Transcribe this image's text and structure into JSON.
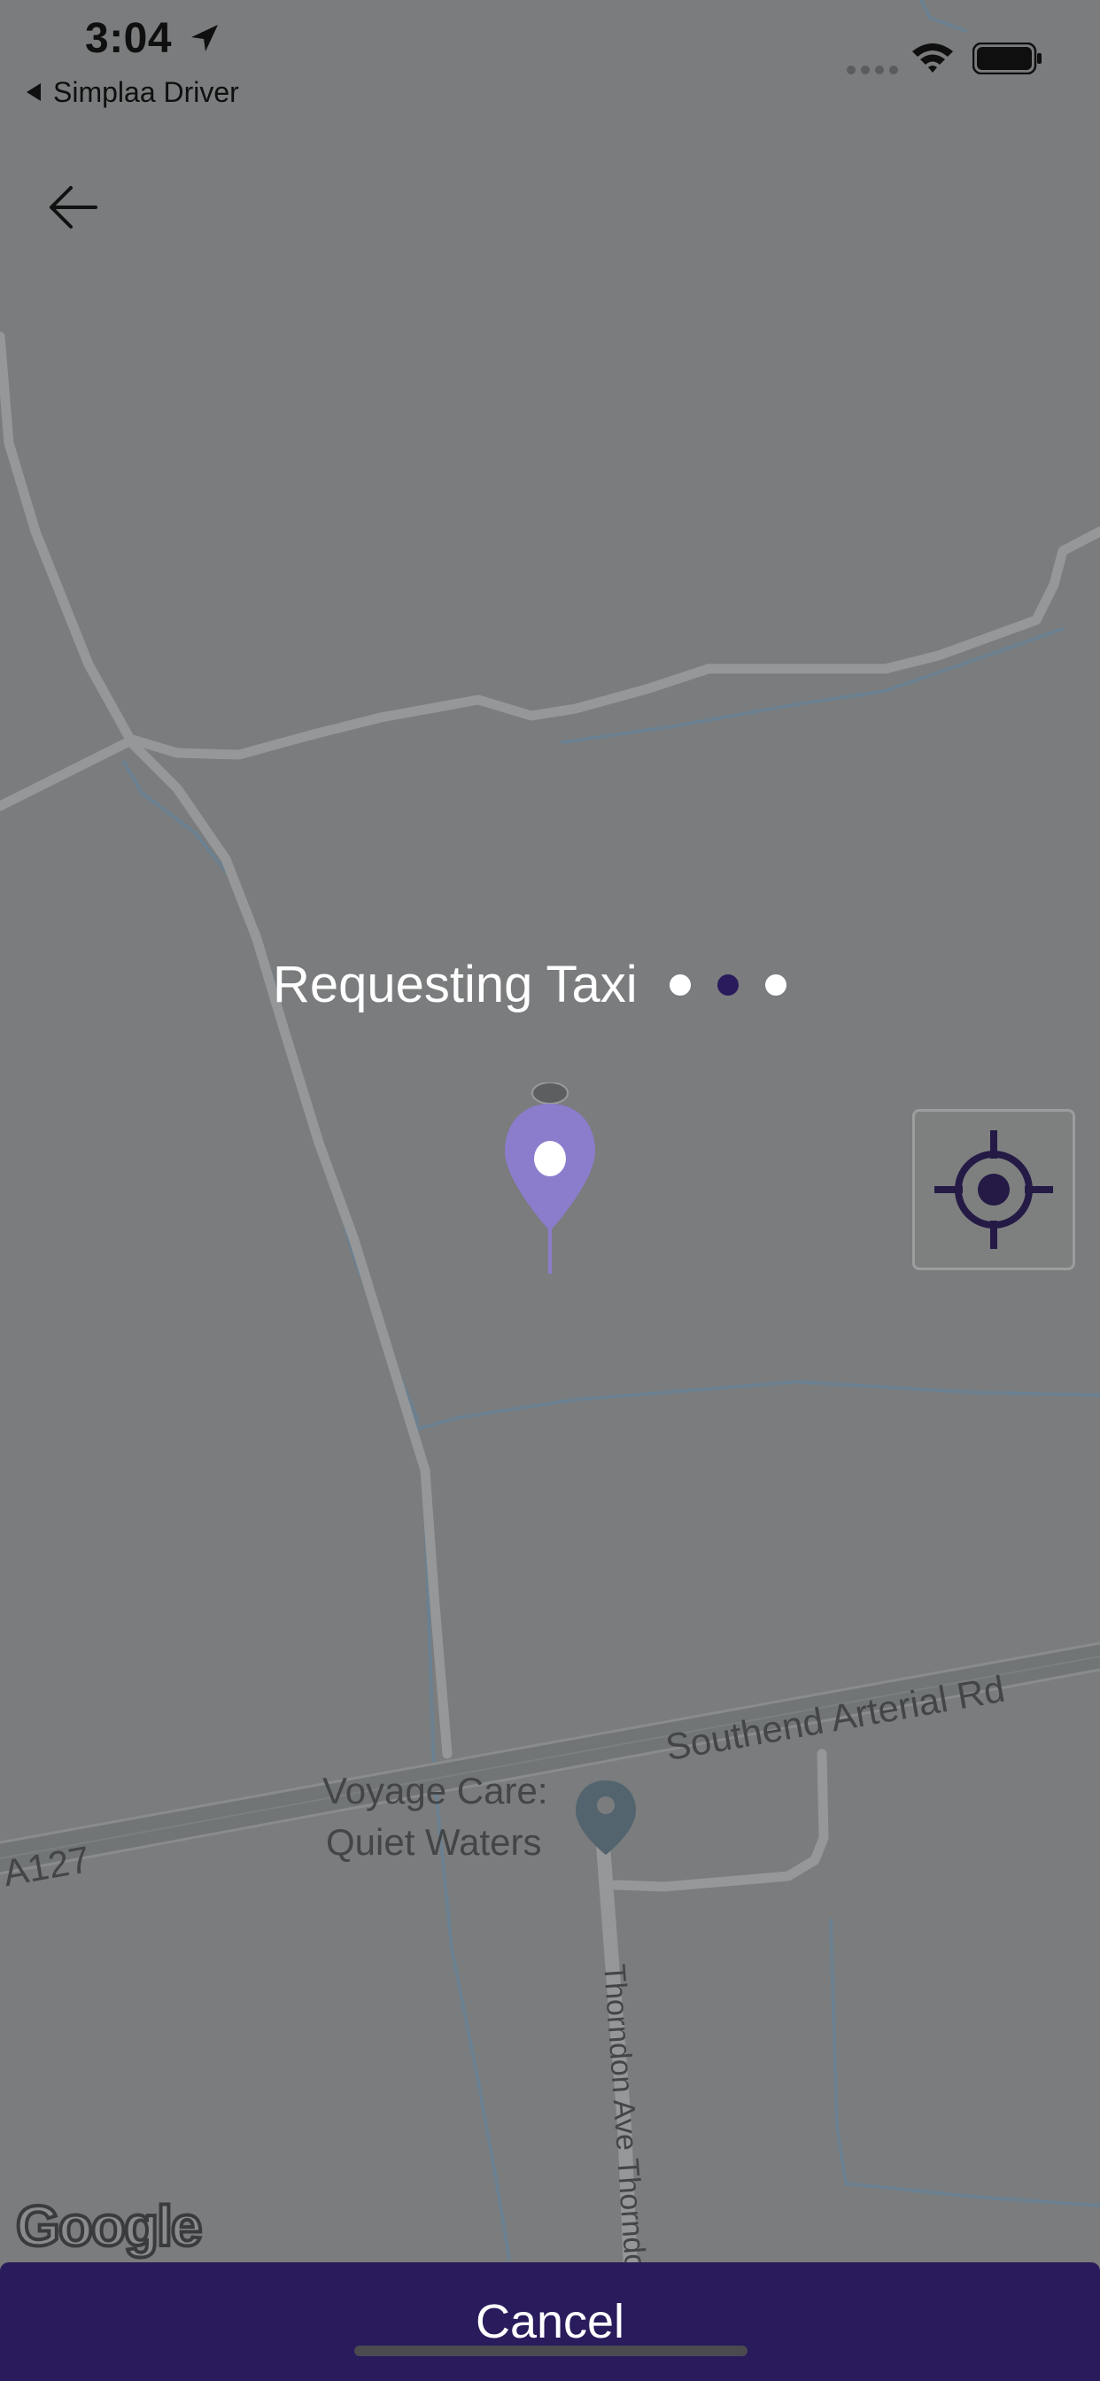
{
  "status_bar": {
    "time": "3:04",
    "back_app_label": "Simplaa Driver",
    "icons": [
      "location-arrow-icon",
      "cellular-signal-icon",
      "wifi-icon",
      "battery-icon"
    ]
  },
  "header": {
    "back_icon": "arrow-left-icon"
  },
  "overlay": {
    "status_text": "Requesting Taxi",
    "dots_total": 3,
    "dot_active_index": 1
  },
  "map": {
    "labels": {
      "road_a127": "A127",
      "road_southend": "Southend Arterial Rd",
      "poi_line1": "Voyage Care:",
      "poi_line2": "Quiet Waters",
      "road_thorndon": "Thorndon Ave  Thorndo"
    },
    "attribution": "Google",
    "pin_color": "#8b7ccc",
    "locate_icon": "crosshair-target-icon"
  },
  "footer": {
    "cancel_label": "Cancel",
    "bar_color": "#2a1b5c"
  }
}
